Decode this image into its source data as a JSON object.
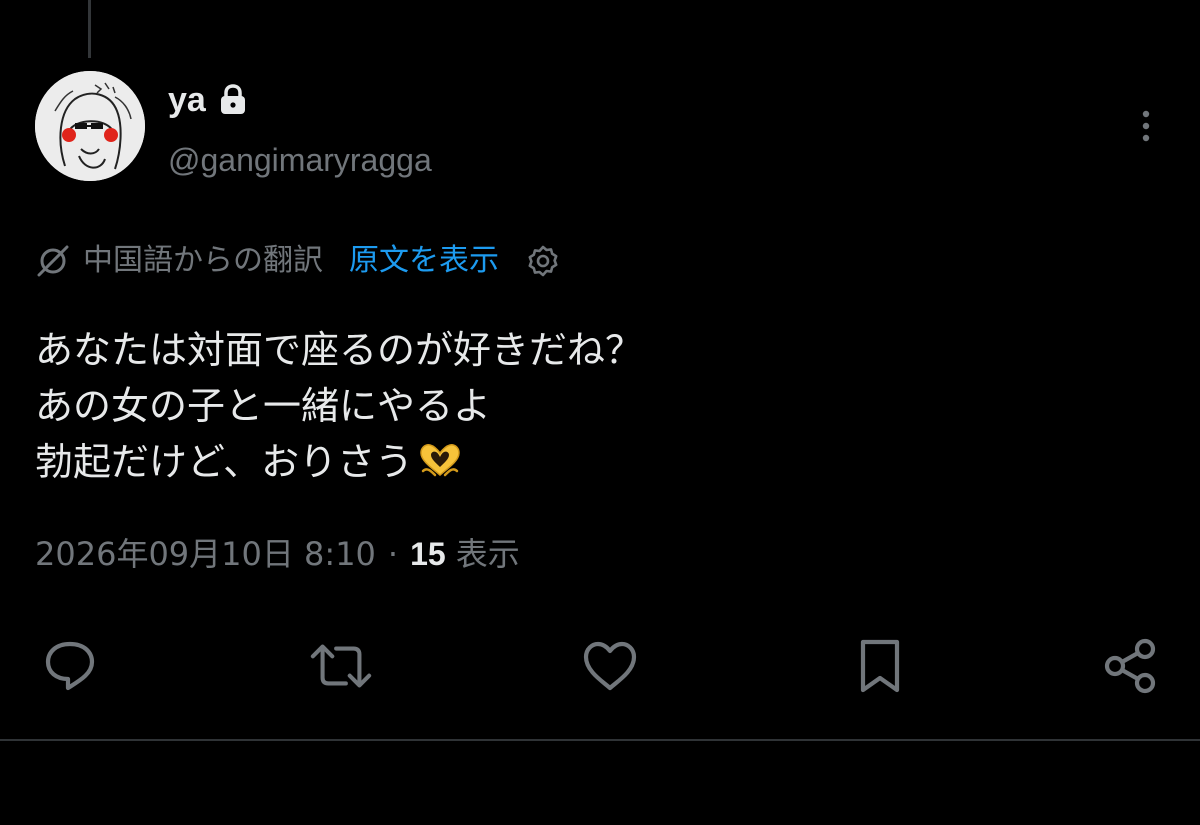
{
  "tweet": {
    "author": {
      "display_name": "ya",
      "handle": "@gangimaryragga",
      "protected_icon": "lock-icon",
      "avatar_icon": "avatar-drawing"
    },
    "translation": {
      "translated_from": "中国語からの翻訳",
      "show_original": "原文を表示",
      "icon": "translate-icon",
      "settings_icon": "settings-icon"
    },
    "text_lines": [
      "あなたは対面で座るのが好きだね？",
      "あの女の子と一緒にやるよ",
      "勃起だけど、おりさう"
    ],
    "emoji": "🫶",
    "timestamp": "2026年09月10日 8:10",
    "separator": "·",
    "views": {
      "count": "15",
      "label": "表示"
    },
    "actions": [
      {
        "name": "reply",
        "icon": "comment-icon"
      },
      {
        "name": "retweet",
        "icon": "retweet-icon"
      },
      {
        "name": "like",
        "icon": "heart-icon"
      },
      {
        "name": "bookmark",
        "icon": "bookmark-icon"
      },
      {
        "name": "share",
        "icon": "share-icon"
      }
    ]
  },
  "colors": {
    "background": "#000000",
    "primary_text": "#e7e9ea",
    "secondary_text": "#71767b",
    "link": "#1d9bf0",
    "divider": "#2f3336"
  }
}
